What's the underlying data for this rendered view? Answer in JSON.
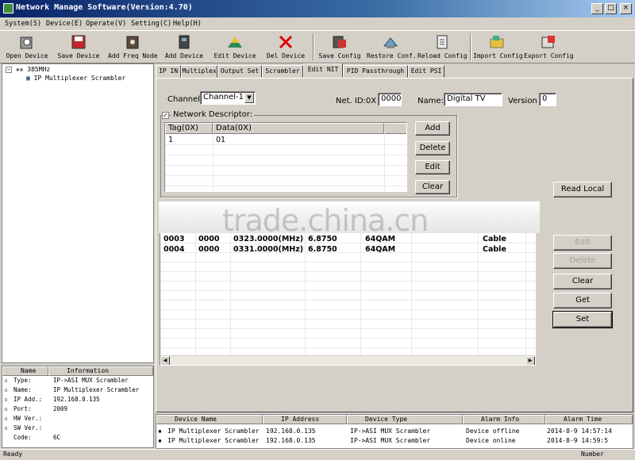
{
  "window": {
    "title": "Network Manage Software(Version:4.70)"
  },
  "menu": [
    "System(S)",
    "Device(E)",
    "Operate(V)",
    "Setting(C)",
    "Help(H)"
  ],
  "toolbar": [
    {
      "label": "Open Device",
      "icon": "open-device-icon"
    },
    {
      "label": "Save Device",
      "icon": "save-device-icon"
    },
    {
      "label": "Add Freq Node",
      "icon": "add-freq-node-icon"
    },
    {
      "label": "Add Device",
      "icon": "add-device-icon"
    },
    {
      "label": "Edit Device",
      "icon": "edit-device-icon"
    },
    {
      "label": "Del Device",
      "icon": "delete-icon"
    },
    {
      "label": "Save Config",
      "icon": "save-config-icon"
    },
    {
      "label": "Restore Conf.",
      "icon": "restore-config-icon"
    },
    {
      "label": "Reload Config",
      "icon": "reload-config-icon"
    },
    {
      "label": "Import Config",
      "icon": "import-config-icon"
    },
    {
      "label": "Export Config",
      "icon": "export-config-icon"
    }
  ],
  "tree": {
    "root": "385MHz",
    "child": "IP Multiplexer Scrambler"
  },
  "info": {
    "headers": [
      "Name",
      "Information"
    ],
    "rows": [
      {
        "name": "Type:",
        "value": "IP->ASI MUX Scrambler"
      },
      {
        "name": "Name:",
        "value": "IP Multiplexer Scrambler"
      },
      {
        "name": "IP Add.:",
        "value": "192.168.0.135"
      },
      {
        "name": "Port:",
        "value": "2009"
      },
      {
        "name": "HW Ver.:",
        "value": ""
      },
      {
        "name": "SW Ver.:",
        "value": ""
      },
      {
        "name": "Code:",
        "value": "6C"
      }
    ]
  },
  "tabs": [
    "IP IN",
    "Multiplex",
    "Output Set",
    "Scrambler",
    "Edit NIT",
    "PID Passthrough",
    "Edit PSI"
  ],
  "active_tab": "Edit NIT",
  "nit": {
    "channel_label": "Channel",
    "channel_value": "Channel-1",
    "netid_label": "Net. ID:0X",
    "netid_value": "0000",
    "name_label": "Name:",
    "name_value": "Digital TV",
    "version_label": "Version",
    "version_value": "0",
    "descriptor_label": "Network Descriptor:",
    "descriptor_checked": true,
    "desc_headers": [
      "Tag(0X)",
      "Data(0X)"
    ],
    "desc_rows": [
      [
        "1",
        "01"
      ]
    ],
    "buttons": {
      "add": "Add",
      "delete": "Delete",
      "edit": "Edit",
      "clear": "Clear"
    }
  },
  "transport": {
    "rows": [
      [
        "0003",
        "0000",
        "0323.0000(MHz)",
        "6.8750",
        "64QAM",
        "Cable"
      ],
      [
        "0004",
        "0000",
        "0331.0000(MHz)",
        "6.8750",
        "64QAM",
        "Cable"
      ]
    ]
  },
  "right_buttons": {
    "read_local": "Read Local",
    "edit": "Edit",
    "delete": "Delete",
    "clear": "Clear",
    "get": "Get",
    "set": "Set"
  },
  "devices": {
    "headers": [
      "Device Name",
      "IP Address",
      "Device Type",
      "Alarm Info",
      "Alarm Time"
    ],
    "rows": [
      [
        "IP Multiplexer Scrambler",
        "192.168.0.135",
        "IP->ASI MUX Scrambler",
        "Device offline",
        "2014-8-9 14:57:14"
      ],
      [
        "IP Multiplexer Scrambler",
        "192.168.0.135",
        "IP->ASI MUX Scrambler",
        "Device online",
        "2014-8-9 14:59:5"
      ]
    ]
  },
  "status": {
    "left": "Ready",
    "right": "Number"
  },
  "watermark": "trade.china.cn"
}
